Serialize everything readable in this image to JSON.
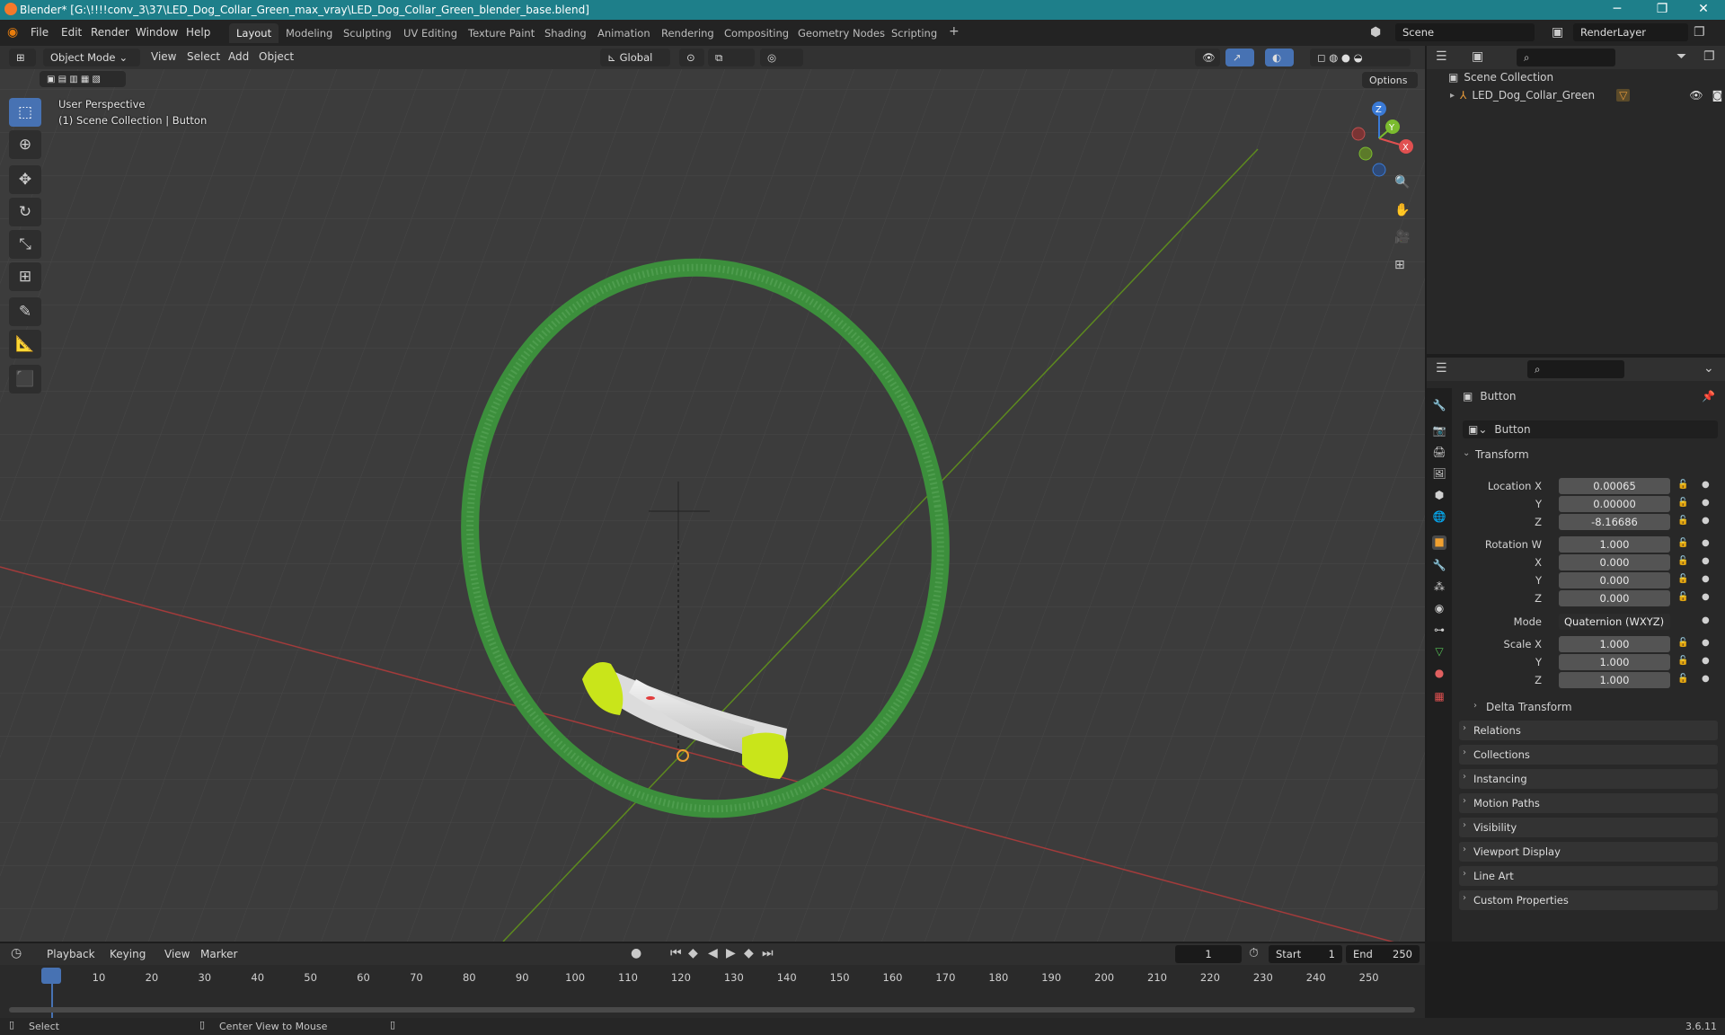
{
  "window": {
    "title": "Blender* [G:\\!!!!conv_3\\37\\LED_Dog_Collar_Green_max_vray\\LED_Dog_Collar_Green_blender_base.blend]",
    "min": "─",
    "max": "❐",
    "close": "✕"
  },
  "menu": [
    "File",
    "Edit",
    "Render",
    "Window",
    "Help"
  ],
  "workspaces": [
    "Layout",
    "Modeling",
    "Sculpting",
    "UV Editing",
    "Texture Paint",
    "Shading",
    "Animation",
    "Rendering",
    "Compositing",
    "Geometry Nodes",
    "Scripting"
  ],
  "add_workspace": "+",
  "scene": {
    "name": "Scene",
    "render_layer": "RenderLayer"
  },
  "viewport": {
    "mode": "Object Mode",
    "menus": [
      "View",
      "Select",
      "Add",
      "Object"
    ],
    "orientation": "Global",
    "options": "Options",
    "perspective": "User Perspective",
    "context": "(1) Scene Collection | Button",
    "gizmo": {
      "x": "X",
      "y": "Y",
      "z": "Z"
    }
  },
  "outliner": {
    "root": "Scene Collection",
    "items": [
      {
        "label": "LED_Dog_Collar_Green"
      }
    ]
  },
  "properties": {
    "object_name": "Button",
    "data_name": "Button",
    "transform_title": "Transform",
    "location": [
      {
        "label": "Location X",
        "value": "0.00065"
      },
      {
        "label": "Y",
        "value": "0.00000"
      },
      {
        "label": "Z",
        "value": "-8.16686"
      }
    ],
    "rotation": [
      {
        "label": "Rotation W",
        "value": "1.000"
      },
      {
        "label": "X",
        "value": "0.000"
      },
      {
        "label": "Y",
        "value": "0.000"
      },
      {
        "label": "Z",
        "value": "0.000"
      }
    ],
    "mode_label": "Mode",
    "mode_value": "Quaternion (WXYZ)",
    "scale": [
      {
        "label": "Scale X",
        "value": "1.000"
      },
      {
        "label": "Y",
        "value": "1.000"
      },
      {
        "label": "Z",
        "value": "1.000"
      }
    ],
    "delta": "Delta Transform",
    "panels": [
      "Relations",
      "Collections",
      "Instancing",
      "Motion Paths",
      "Visibility",
      "Viewport Display",
      "Line Art",
      "Custom Properties"
    ]
  },
  "timeline": {
    "menus": [
      "Playback",
      "Keying",
      "View",
      "Marker"
    ],
    "current_frame": "1",
    "start_label": "Start",
    "start": "1",
    "end_label": "End",
    "end": "250",
    "ticks": [
      "1",
      "10",
      "20",
      "30",
      "40",
      "50",
      "60",
      "70",
      "80",
      "90",
      "100",
      "110",
      "120",
      "130",
      "140",
      "150",
      "160",
      "170",
      "180",
      "190",
      "200",
      "210",
      "220",
      "230",
      "240",
      "250"
    ]
  },
  "statusbar": {
    "select": "Select",
    "center": "Center View to Mouse",
    "version": "3.6.11"
  },
  "colors": {
    "accent": "#4772b3",
    "titlebar": "#1e7f8a",
    "collar": "#3a8a3a",
    "button_lime": "#d5f01e"
  }
}
